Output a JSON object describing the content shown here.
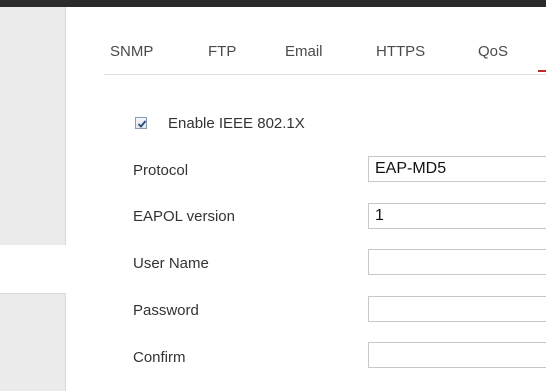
{
  "tabs": [
    {
      "label": "SNMP"
    },
    {
      "label": "FTP"
    },
    {
      "label": "Email"
    },
    {
      "label": "HTTPS"
    },
    {
      "label": "QoS"
    }
  ],
  "form": {
    "enable_checkbox": {
      "label": "Enable IEEE 802.1X",
      "checked": true
    },
    "protocol": {
      "label": "Protocol",
      "value": "EAP-MD5"
    },
    "eapol_version": {
      "label": "EAPOL version",
      "value": "1"
    },
    "user_name": {
      "label": "User Name",
      "value": ""
    },
    "password": {
      "label": "Password",
      "value": ""
    },
    "confirm": {
      "label": "Confirm",
      "value": ""
    }
  },
  "colors": {
    "active_tab_accent": "#c0282e",
    "top_bar": "#2b2b2b",
    "sidebar": "#ebebeb"
  }
}
